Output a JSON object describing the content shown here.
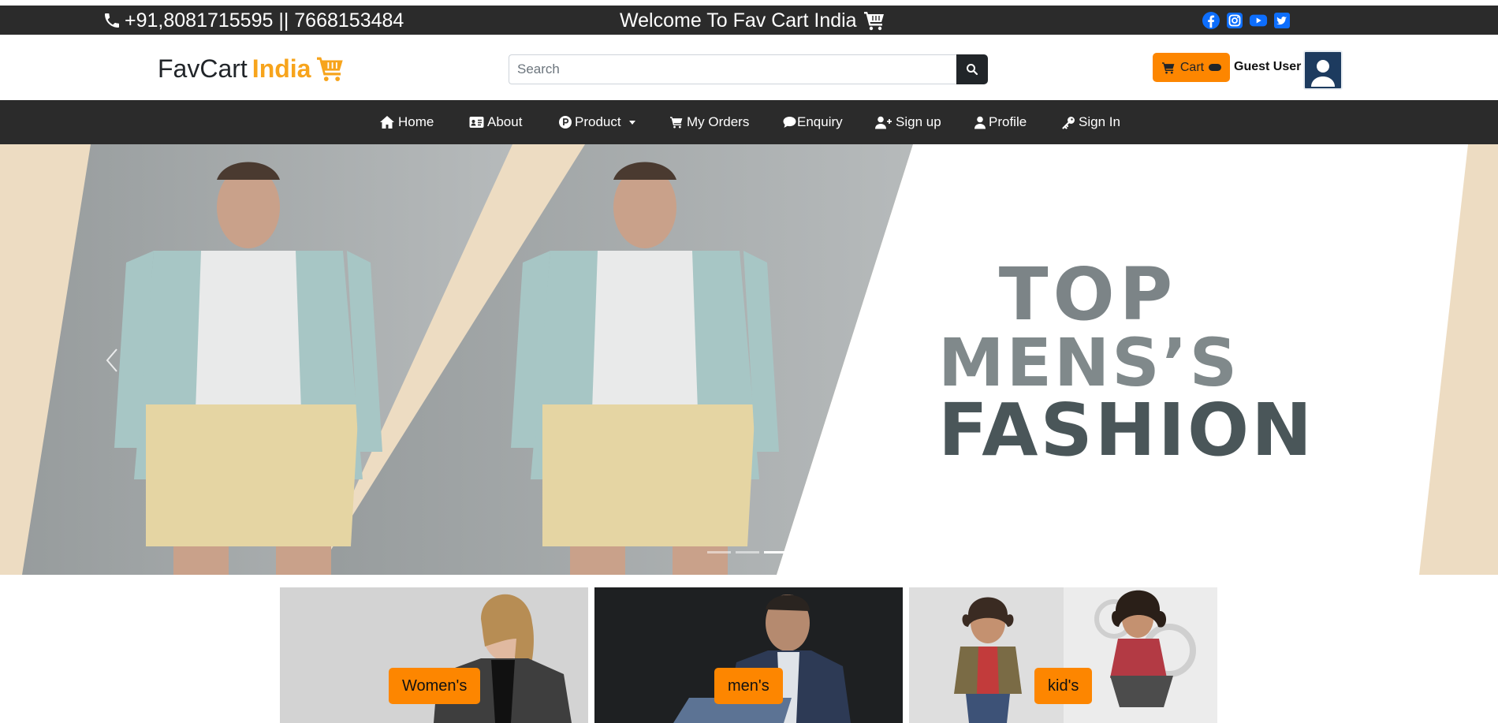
{
  "topbar": {
    "phone": "+91,8081715595 || 7668153484",
    "welcome": "Welcome To Fav Cart India",
    "social": [
      "facebook-icon",
      "instagram-icon",
      "youtube-icon",
      "twitter-icon"
    ]
  },
  "header": {
    "brand_part1": "FavCart",
    "brand_part2": "India",
    "search_placeholder": "Search",
    "cart_label": "Cart",
    "cart_count": "0",
    "user_name": "Guest User"
  },
  "nav": {
    "items": [
      {
        "label": "Home",
        "icon": "home-icon"
      },
      {
        "label": "About",
        "icon": "id-card-icon"
      },
      {
        "label": "Product",
        "icon": "product-p-icon"
      },
      {
        "label": "My Orders",
        "icon": "cart-icon"
      },
      {
        "label": "Enquiry",
        "icon": "chat-bubble-icon"
      },
      {
        "label": "Sign up",
        "icon": "user-plus-icon"
      },
      {
        "label": "Profile",
        "icon": "user-icon"
      },
      {
        "label": "Sign In",
        "icon": "key-icon"
      }
    ]
  },
  "hero": {
    "line1": "TOP",
    "line2": "MENS’S",
    "line3": "FASHION",
    "slide_count": 3,
    "active_slide": 3
  },
  "categories": [
    {
      "label": "Women's"
    },
    {
      "label": "men's"
    },
    {
      "label": "kid's"
    }
  ],
  "colors": {
    "accent": "#fd8600",
    "brand_accent": "#f7a41c",
    "dark": "#2b2b2b",
    "social_blue": "#0d6efd"
  }
}
